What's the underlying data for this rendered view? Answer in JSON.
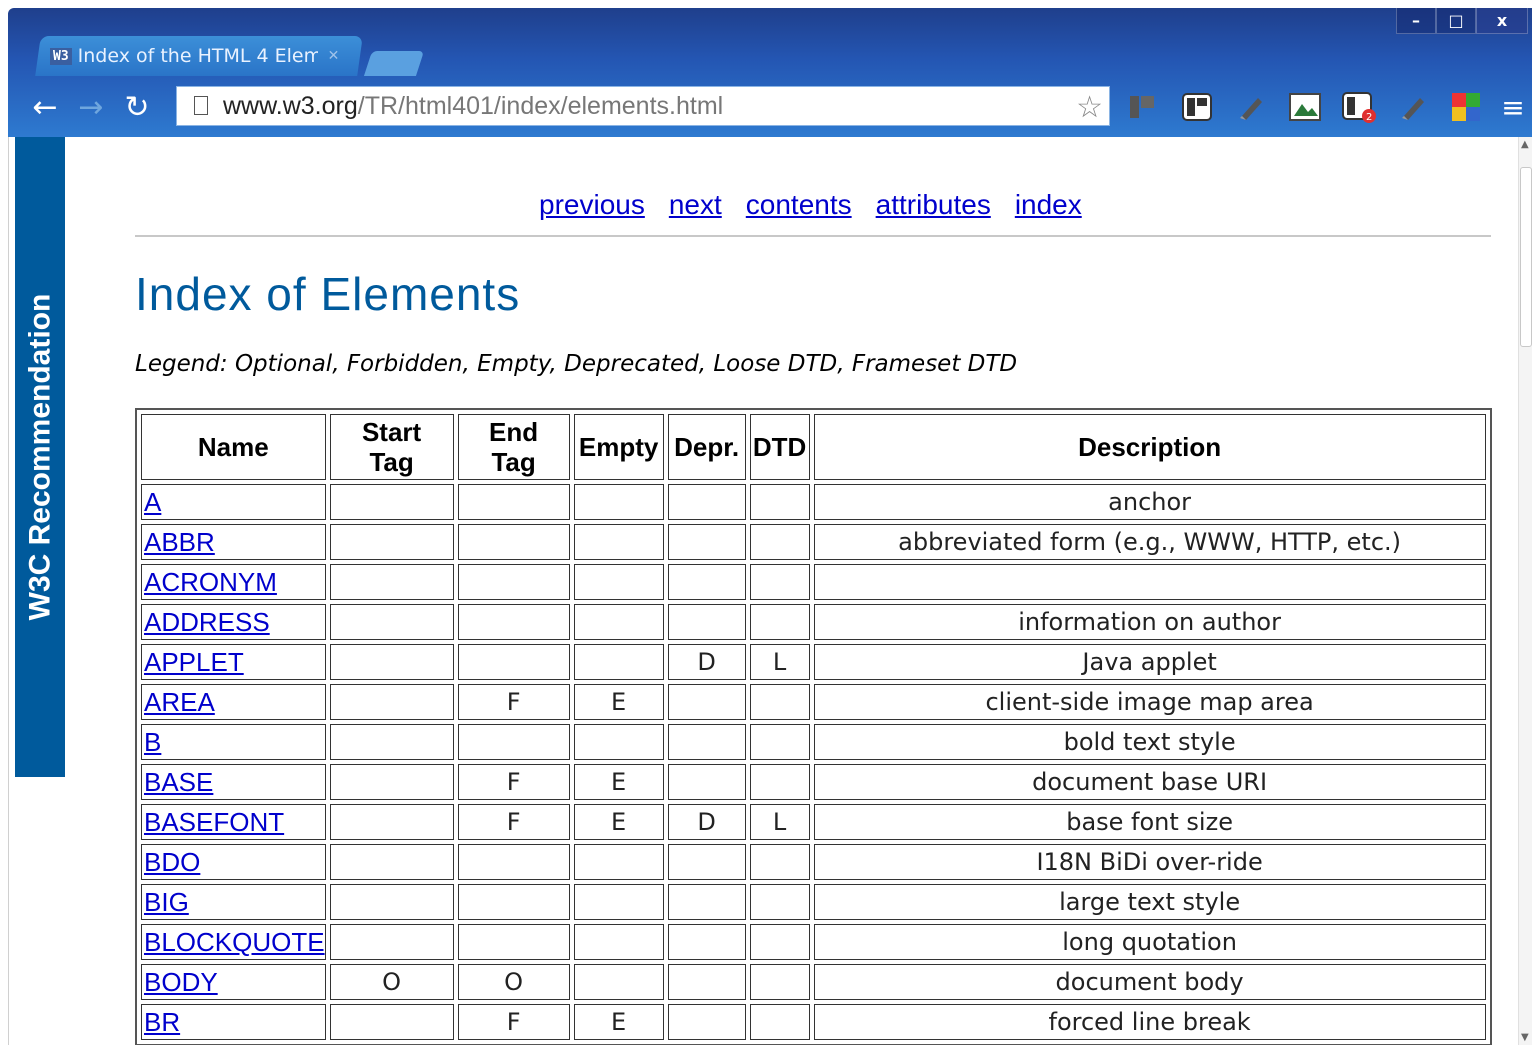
{
  "browser": {
    "tab_title": "Index of the HTML 4 Elem",
    "tab_icon_text": "W3",
    "url_host": "www.w3.org",
    "url_path": "/TR/html401/index/elements.html",
    "window_buttons": [
      "–",
      "□",
      "x"
    ]
  },
  "sidebar_banner": "W3C Recommendation",
  "nav_links": [
    "previous",
    "next",
    "contents",
    "attributes",
    "index"
  ],
  "page_title": "Index of Elements",
  "legend": {
    "prefix": "Legend: ",
    "items": [
      "Optional",
      "Forbidden",
      "Empty",
      "Deprecated",
      "Loose DTD",
      "Frameset DTD"
    ]
  },
  "table": {
    "headers": [
      "Name",
      "Start Tag",
      "End Tag",
      "Empty",
      "Depr.",
      "DTD",
      "Description"
    ],
    "rows": [
      {
        "name": "A",
        "start": "",
        "end": "",
        "empty": "",
        "depr": "",
        "dtd": "",
        "desc": "anchor"
      },
      {
        "name": "ABBR",
        "start": "",
        "end": "",
        "empty": "",
        "depr": "",
        "dtd": "",
        "desc": "abbreviated form (e.g., WWW, HTTP, etc.)"
      },
      {
        "name": "ACRONYM",
        "start": "",
        "end": "",
        "empty": "",
        "depr": "",
        "dtd": "",
        "desc": ""
      },
      {
        "name": "ADDRESS",
        "start": "",
        "end": "",
        "empty": "",
        "depr": "",
        "dtd": "",
        "desc": "information on author"
      },
      {
        "name": "APPLET",
        "start": "",
        "end": "",
        "empty": "",
        "depr": "D",
        "dtd": "L",
        "desc": "Java applet"
      },
      {
        "name": "AREA",
        "start": "",
        "end": "F",
        "empty": "E",
        "depr": "",
        "dtd": "",
        "desc": "client-side image map area"
      },
      {
        "name": "B",
        "start": "",
        "end": "",
        "empty": "",
        "depr": "",
        "dtd": "",
        "desc": "bold text style"
      },
      {
        "name": "BASE",
        "start": "",
        "end": "F",
        "empty": "E",
        "depr": "",
        "dtd": "",
        "desc": "document base URI"
      },
      {
        "name": "BASEFONT",
        "start": "",
        "end": "F",
        "empty": "E",
        "depr": "D",
        "dtd": "L",
        "desc": "base font size"
      },
      {
        "name": "BDO",
        "start": "",
        "end": "",
        "empty": "",
        "depr": "",
        "dtd": "",
        "desc": "I18N BiDi over-ride"
      },
      {
        "name": "BIG",
        "start": "",
        "end": "",
        "empty": "",
        "depr": "",
        "dtd": "",
        "desc": "large text style"
      },
      {
        "name": "BLOCKQUOTE",
        "start": "",
        "end": "",
        "empty": "",
        "depr": "",
        "dtd": "",
        "desc": "long quotation"
      },
      {
        "name": "BODY",
        "start": "O",
        "end": "O",
        "empty": "",
        "depr": "",
        "dtd": "",
        "desc": "document body"
      },
      {
        "name": "BR",
        "start": "",
        "end": "F",
        "empty": "E",
        "depr": "",
        "dtd": "",
        "desc": "forced line break"
      }
    ]
  },
  "colors": {
    "link": "#0000cc",
    "title": "#005a9c",
    "banner": "#005a9c",
    "chrome_top": "#1f3f8c",
    "chrome_bottom": "#2e7ad0"
  }
}
